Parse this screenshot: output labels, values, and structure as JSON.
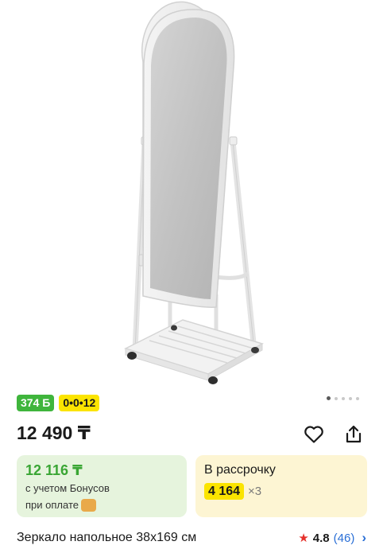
{
  "product": {
    "image_alt": "Зеркало напольное 38x169 см",
    "badges": {
      "bonus": "374 Б",
      "installment": "0•0•12"
    },
    "gallery": {
      "total_dots": 5,
      "active_index": 0
    },
    "price": "12 490 ₸",
    "actions": {
      "favorite_icon": "heart-icon",
      "share_icon": "share-icon"
    },
    "bonus_card": {
      "price": "12 116 ₸",
      "line1": "с учетом Бонусов",
      "line2": "при оплате"
    },
    "installment_card": {
      "title": "В рассрочку",
      "amount": "4 164",
      "multiplier": "×3"
    },
    "title": "Зеркало напольное 38x169 см",
    "rating": {
      "value": "4.8",
      "reviews": "(46)"
    }
  },
  "colors": {
    "bonus_green": "#3fb53c",
    "installment_yellow": "#fbe400",
    "link_blue": "#2a6fd6",
    "star_red": "#e5312b"
  }
}
